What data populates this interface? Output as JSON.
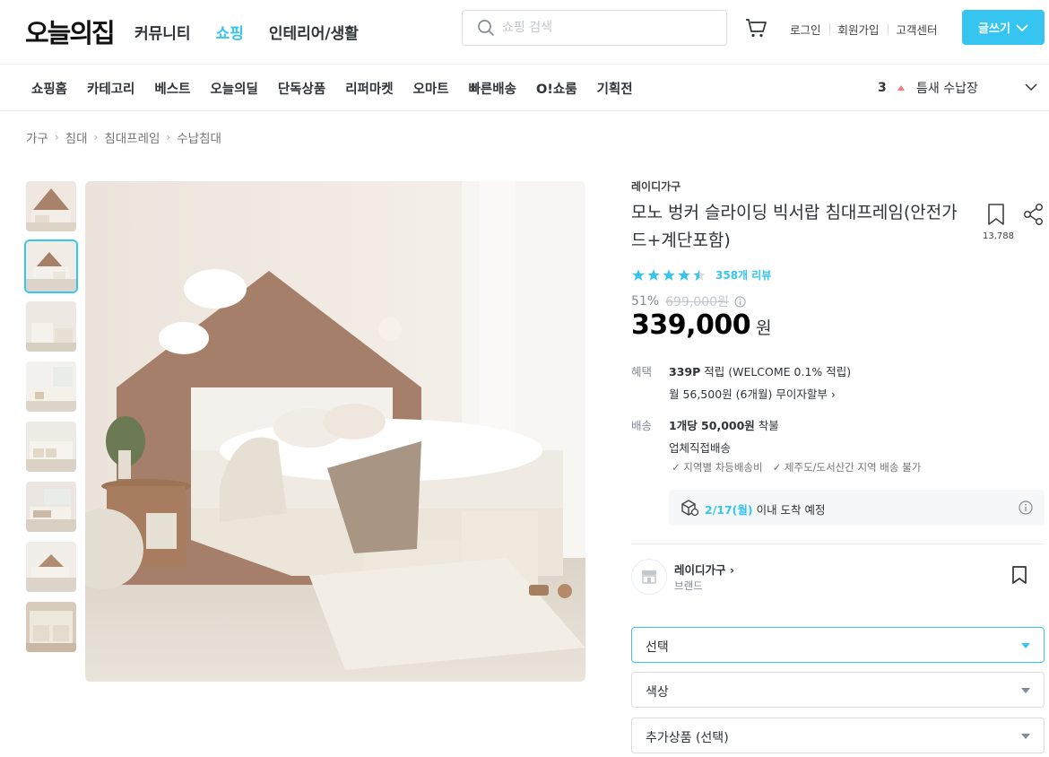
{
  "header": {
    "logo": "오늘의집",
    "nav": [
      "커뮤니티",
      "쇼핑",
      "인테리어/생활"
    ],
    "nav_active_index": 1,
    "search_placeholder": "쇼핑 검색",
    "links": [
      "로그인",
      "회원가입",
      "고객센터"
    ],
    "write_button": "글쓰기",
    "cart_icon": "cart-icon"
  },
  "subnav": {
    "items": [
      "쇼핑홈",
      "카테고리",
      "베스트",
      "오늘의딜",
      "단독상품",
      "리퍼마켓",
      "오마트",
      "빠른배송",
      "O!쇼룸",
      "기획전"
    ],
    "ranking_number": "3",
    "ranking_keyword": "틈새 수납장"
  },
  "breadcrumb": [
    "가구",
    "침대",
    "침대프레임",
    "수납침대"
  ],
  "gallery": {
    "thumbnail_count": 8,
    "selected_index": 1
  },
  "product": {
    "brand": "레이디가구",
    "title": "모노 벙커 슬라이딩 빅서랍 침대프레임(안전가드+계단포함)",
    "bookmark_count": "13,788",
    "rating": 4.5,
    "review_text": "358개 리뷰",
    "discount": "51%",
    "original_price": "699,000원",
    "price": "339,000",
    "currency": "원"
  },
  "benefit": {
    "label": "혜택",
    "points_bold": "339P",
    "points_rest": " 적립 (WELCOME 0.1% 적립)",
    "installment": "월 56,500원 (6개월) 무이자할부"
  },
  "delivery": {
    "label": "배송",
    "fee_bold": "1개당 50,000원",
    "fee_rest": " 착불",
    "method": "업체직접배송",
    "notes": [
      "지역별 차등배송비",
      "제주도/도서산간 지역 배송 불가"
    ],
    "arrival_date": "2/17(월)",
    "arrival_rest": " 이내 도착 예정"
  },
  "brand_box": {
    "name": "레이디가구",
    "sub": "브랜드"
  },
  "options": [
    "선택",
    "색상",
    "추가상품 (선택)"
  ],
  "colors": {
    "accent": "#35c5f0",
    "text": "#2f3438",
    "muted": "#828c94",
    "border": "#dadce0"
  }
}
